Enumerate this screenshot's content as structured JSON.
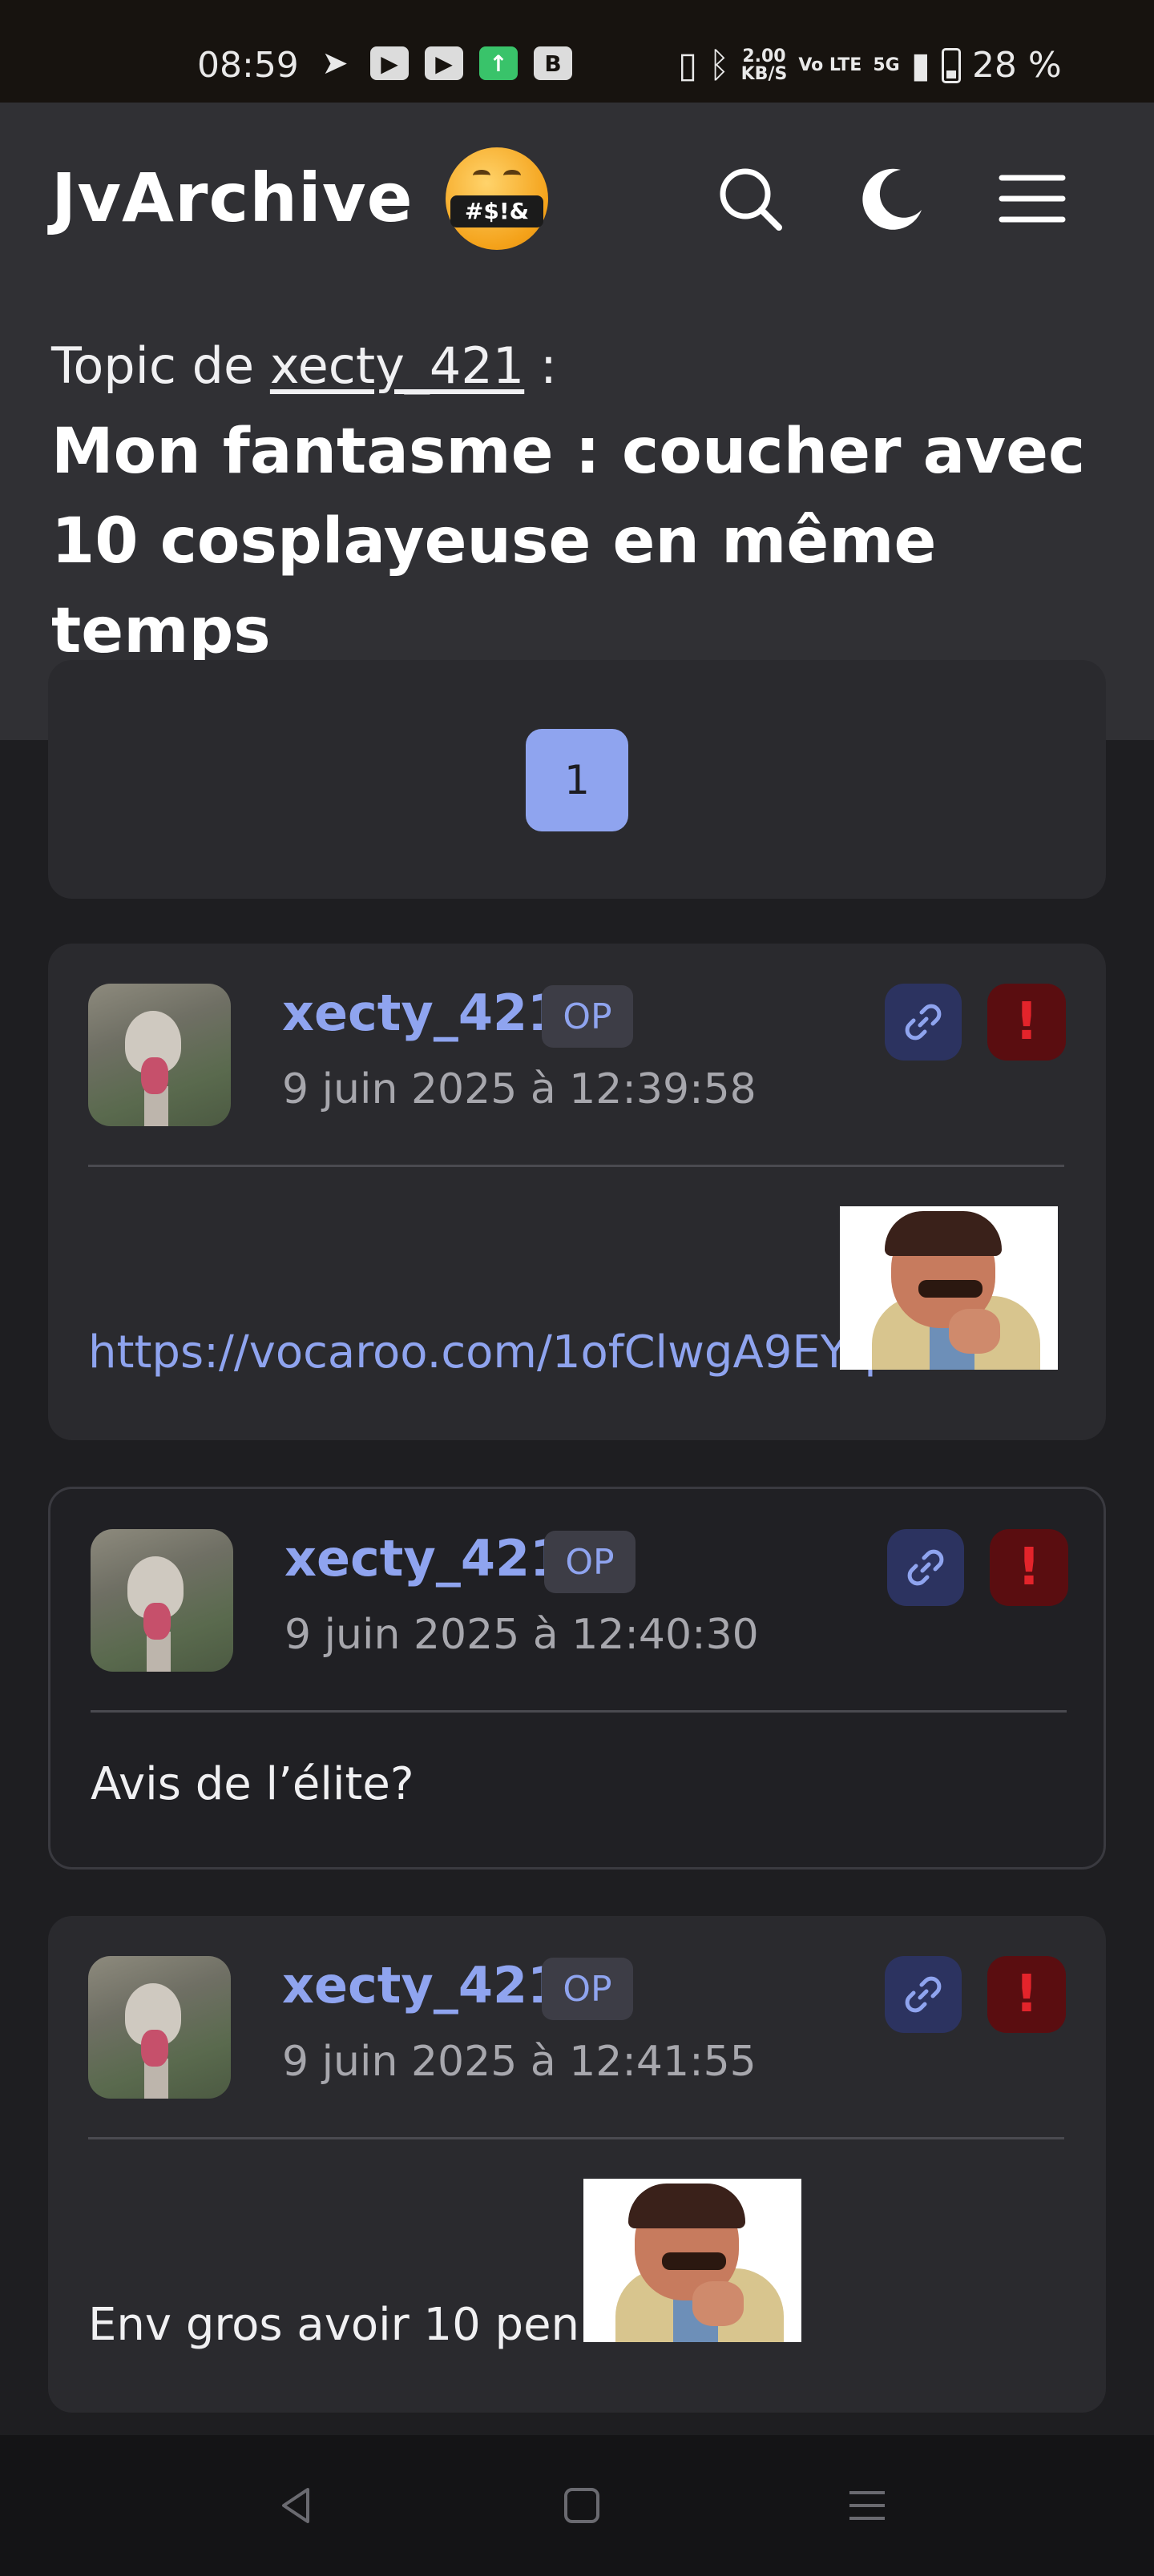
{
  "status_bar": {
    "time": "08:59",
    "net_speed": "2.00",
    "net_unit": "KB/S",
    "volte": "Vo LTE",
    "signal": "5G",
    "battery": "28 %"
  },
  "header": {
    "brand": "JvArchive",
    "brand_emoji_text": "#$!&",
    "topic_prefix": "Topic de",
    "topic_author": "xecty_421",
    "topic_suffix": ":",
    "topic_title": "Mon fantasme : coucher avec 10 cosplayeuse en même temps"
  },
  "pagination": {
    "current_page": "1"
  },
  "posts": [
    {
      "author": "xecty_421",
      "badge": "OP",
      "date": "9 juin 2025 à 12:39:58",
      "body": "https://vocaroo.com/1ofClwgA9EYq",
      "report_label": "!"
    },
    {
      "author": "xecty_421",
      "badge": "OP",
      "date": "9 juin 2025 à 12:40:30",
      "body": "Avis de l’élite?",
      "report_label": "!"
    },
    {
      "author": "xecty_421",
      "badge": "OP",
      "date": "9 juin 2025 à 12:41:55",
      "body": "Env gros avoir 10 penis",
      "report_label": "!"
    }
  ],
  "colors": {
    "accent": "#8fa4ef",
    "header_bg": "#303034",
    "page_bg": "#1e1e21",
    "report": "#e3242b"
  },
  "icons": {
    "search": "search-icon",
    "theme": "moon-icon",
    "menu": "hamburger-icon",
    "link": "link-icon",
    "report": "exclamation-icon"
  }
}
